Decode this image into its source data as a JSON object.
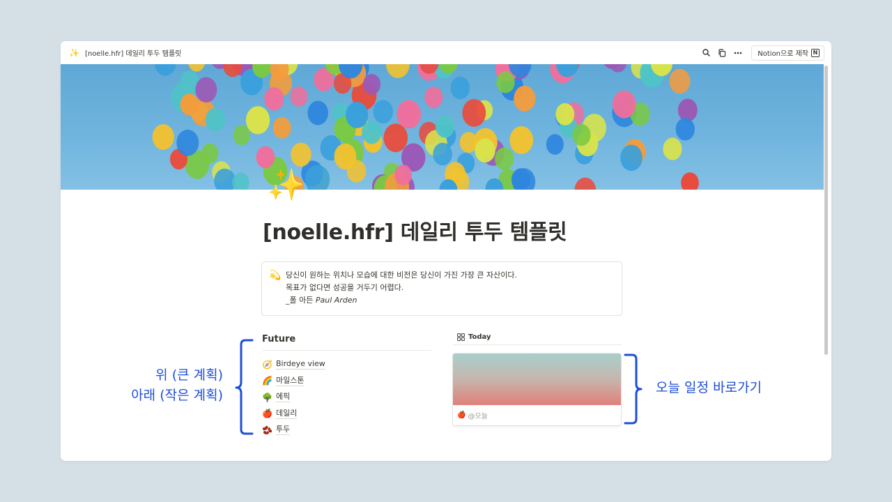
{
  "window": {
    "page_icon": "✨",
    "tab_title": "[noelle.hfr] 데일리 투두 템플릿",
    "made_with_label": "Notion으로 제작",
    "made_with_logo": "N",
    "icons": [
      "search-icon",
      "duplicate-icon",
      "more-icon",
      "notion-logo-icon"
    ]
  },
  "page": {
    "emoji": "✨",
    "title": "[noelle.hfr] 데일리 투두 템플릿",
    "callout": {
      "icon": "💫",
      "line1": "당신이 원하는 위치나 모습에 대한 비전은 당신이 가진 가장 큰 자산이다.",
      "line2": "목표가 없다면 성공을 거두기 어렵다.",
      "author_prefix": "_폴 아든 ",
      "author_name": "Paul Arden"
    }
  },
  "future": {
    "title": "Future",
    "items": [
      {
        "emoji": "🧭",
        "label": "Birdeye view"
      },
      {
        "emoji": "🌈",
        "label": "마일스톤"
      },
      {
        "emoji": "🌳",
        "label": "에픽"
      },
      {
        "emoji": "🍎",
        "label": "데일리"
      },
      {
        "emoji": "🫘",
        "label": "투두"
      }
    ]
  },
  "today": {
    "title": "Today",
    "card": {
      "emoji": "🍎",
      "label": "@오늘"
    }
  },
  "annotations": {
    "left_line1": "위 (큰 계획)",
    "left_line2": "아래 (작은 계획)",
    "right": "오늘 일정 바로가기",
    "color": "#1d4ed8"
  }
}
